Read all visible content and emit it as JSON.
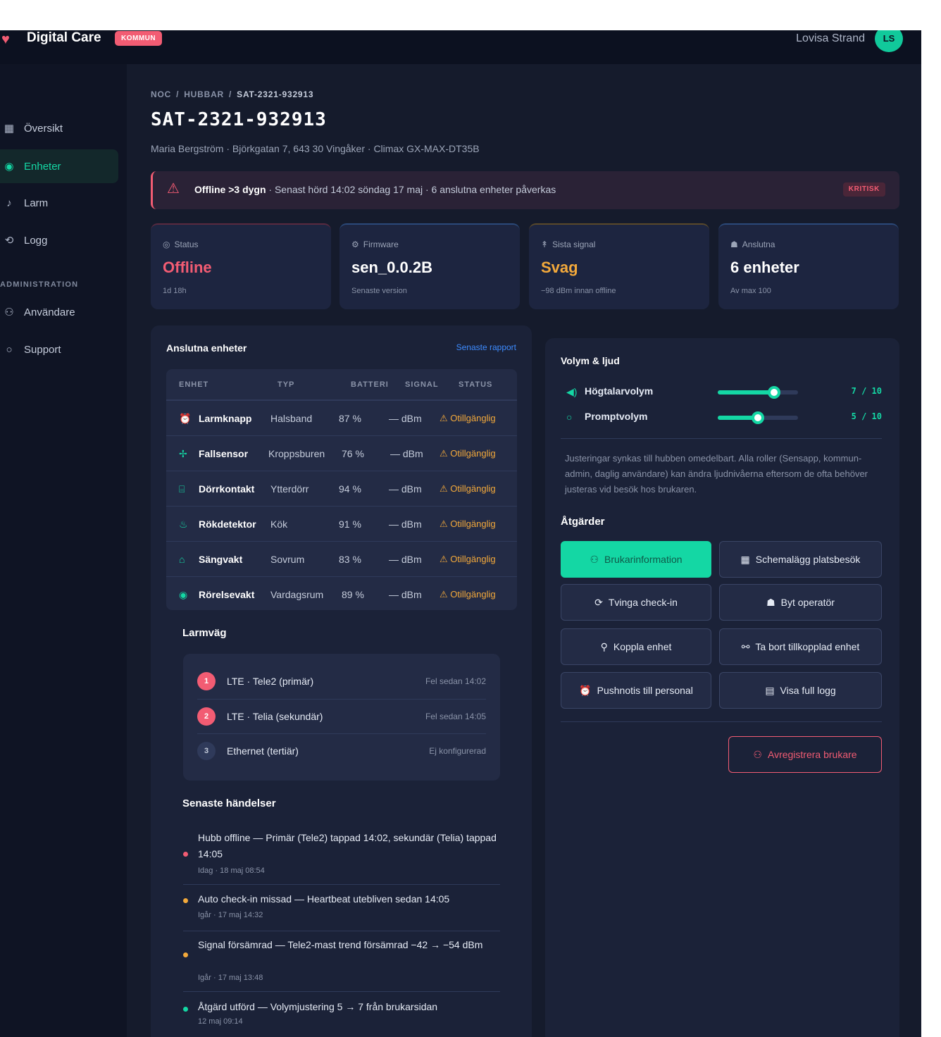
{
  "header": {
    "brand": "Digital Care",
    "brand_badge": "KOMMUN",
    "user_name": "Lovisa Strand",
    "user_initials": "LS"
  },
  "sidebar": {
    "items": [
      {
        "label": "Översikt",
        "icon": "grid-icon",
        "glyph": "▦"
      },
      {
        "label": "Enheter",
        "icon": "signal-icon",
        "glyph": "◉"
      },
      {
        "label": "Larm",
        "icon": "bell-icon",
        "glyph": "♪"
      },
      {
        "label": "Logg",
        "icon": "history-icon",
        "glyph": "⟲"
      }
    ],
    "section_admin": "ADMINISTRATION",
    "admin_items": [
      {
        "label": "Användare",
        "icon": "users-icon",
        "glyph": "⚇"
      },
      {
        "label": "Support",
        "icon": "chat-icon",
        "glyph": "○"
      }
    ]
  },
  "page": {
    "breadcrumb": [
      "NOC",
      "HUBBAR",
      "SAT-2321-932913"
    ],
    "title": "SAT-2321-932913",
    "subtitle": "Maria Bergström · Björkgatan 7, 643 30 Vingåker · Climax GX-MAX-DT35B"
  },
  "alert": {
    "strong": "Offline >3 dygn",
    "text": " · Senast hörd 14:02 söndag 17 maj · 6 anslutna enheter påverkas",
    "badge": "KRITISK"
  },
  "stats": [
    {
      "label": "Status",
      "value": "Offline",
      "sub": "1d 18h",
      "color": "#f25c73",
      "glyph": "◎"
    },
    {
      "label": "Firmware",
      "value": "sen_0.0.2B",
      "sub": "Senaste version",
      "color": "#ffffff",
      "glyph": "⚙"
    },
    {
      "label": "Sista signal",
      "value": "Svag",
      "sub": "−98 dBm innan offline",
      "color": "#f3a93b",
      "glyph": "↟"
    },
    {
      "label": "Anslutna",
      "value": "6 enheter",
      "sub": "Av max 100",
      "color": "#ffffff",
      "glyph": "☗"
    }
  ],
  "devices": {
    "title": "Anslutna enheter",
    "link": "Senaste rapport",
    "columns": [
      "ENHET",
      "TYP",
      "BATTERI",
      "SIGNAL",
      "STATUS"
    ],
    "rows": [
      {
        "name": "Larmknapp",
        "type": "Halsband",
        "battery": "87 %",
        "signal": "— dBm",
        "status": "⚠ Otillgänglig",
        "icon": "alarm-icon",
        "glyph": "⏰"
      },
      {
        "name": "Fallsensor",
        "type": "Kroppsburen",
        "battery": "76 %",
        "signal": "— dBm",
        "status": "⚠ Otillgänglig",
        "icon": "pulse-icon",
        "glyph": "✢"
      },
      {
        "name": "Dörrkontakt",
        "type": "Ytterdörr",
        "battery": "94 %",
        "signal": "— dBm",
        "status": "⚠ Otillgänglig",
        "icon": "door-icon",
        "glyph": "⌸"
      },
      {
        "name": "Rökdetektor",
        "type": "Kök",
        "battery": "91 %",
        "signal": "— dBm",
        "status": "⚠ Otillgänglig",
        "icon": "flame-icon",
        "glyph": "♨"
      },
      {
        "name": "Sängvakt",
        "type": "Sovrum",
        "battery": "83 %",
        "signal": "— dBm",
        "status": "⚠ Otillgänglig",
        "icon": "bed-icon",
        "glyph": "⌂"
      },
      {
        "name": "Rörelsevakt",
        "type": "Vardagsrum",
        "battery": "89 %",
        "signal": "— dBm",
        "status": "⚠ Otillgänglig",
        "icon": "eye-icon",
        "glyph": "◉"
      }
    ]
  },
  "route": {
    "title": "Larmväg",
    "items": [
      {
        "num": "1",
        "name": "LTE · Tele2 (primär)",
        "status": "Fel sedan 14:02"
      },
      {
        "num": "2",
        "name": "LTE · Telia (sekundär)",
        "status": "Fel sedan 14:05"
      },
      {
        "num": "3",
        "name": "Ethernet (tertiär)",
        "status": "Ej konfigurerad"
      }
    ]
  },
  "events": {
    "title": "Senaste händelser",
    "items": [
      {
        "text": "Hubb offline — Primär (Tele2) tappad 14:02, sekundär (Telia) tappad 14:05",
        "time": "Idag · 18 maj 08:54",
        "color": "#f25c73"
      },
      {
        "text": "Auto check-in missad — Heartbeat utebliven sedan 14:05",
        "time": "Igår · 17 maj 14:32",
        "color": "#f3a93b"
      },
      {
        "text": "Signal försämrad — Tele2-mast trend försämrad −42 → −54 dBm",
        "time": "Igår · 17 maj 13:48",
        "color": "#f3a93b"
      },
      {
        "text": "Åtgärd utförd — Volymjustering 5 → 7 från brukarsidan",
        "time": "12 maj 09:14",
        "color": "#14d7a4"
      }
    ]
  },
  "volume": {
    "title": "Volym & ljud",
    "speaker": {
      "label": "Högtalarvolym",
      "value": 7,
      "max": 10,
      "display": "7 / 10"
    },
    "prompt": {
      "label": "Promptvolym",
      "value": 5,
      "max": 10,
      "display": "5 / 10"
    },
    "note": "Justeringar synkas till hubben omedelbart. Alla roller (Sensapp, kommun-admin, daglig användare) kan ändra ljudnivåerna eftersom de ofta behöver justeras vid besök hos brukaren."
  },
  "actions": {
    "title": "Åtgärder",
    "buttons": [
      {
        "label": "Brukarinformation",
        "glyph": "⚇",
        "icon": "user-icon"
      },
      {
        "label": "Schemalägg platsbesök",
        "glyph": "▦",
        "icon": "calendar-icon"
      },
      {
        "label": "Tvinga check-in",
        "glyph": "⟳",
        "icon": "refresh-icon"
      },
      {
        "label": "Byt operatör",
        "glyph": "☗",
        "icon": "operator-icon"
      },
      {
        "label": "Koppla enhet",
        "glyph": "⚲",
        "icon": "link-icon"
      },
      {
        "label": "Ta bort tillkopplad enhet",
        "glyph": "⚯",
        "icon": "unlink-icon"
      },
      {
        "label": "Pushnotis till personal",
        "glyph": "⏰",
        "icon": "notify-icon"
      },
      {
        "label": "Visa full logg",
        "glyph": "▤",
        "icon": "document-icon"
      }
    ],
    "danger": {
      "label": "Avregistrera brukare",
      "glyph": "⚇",
      "icon": "user-remove-icon"
    }
  }
}
